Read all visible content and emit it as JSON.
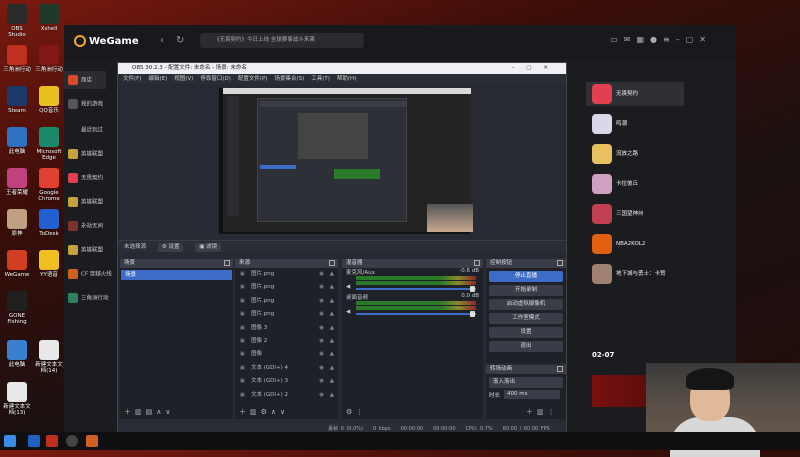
{
  "desktop": {
    "icons": [
      {
        "label": "OBS Studio",
        "color": "#2b2b2b"
      },
      {
        "label": "Xshell",
        "color": "#1f3a2a"
      },
      {
        "label": "三角洲行动",
        "color": "#c03020"
      },
      {
        "label": "三角洲行动",
        "color": "#801818"
      },
      {
        "label": "Steam",
        "color": "#1b3a6b"
      },
      {
        "label": "QQ音乐",
        "color": "#e8c020"
      },
      {
        "label": "此电脑",
        "color": "#3070c0"
      },
      {
        "label": "Microsoft Edge",
        "color": "#1a8a6a"
      },
      {
        "label": "王者荣耀",
        "color": "#c04080"
      },
      {
        "label": "Google Chrome",
        "color": "#e04030"
      },
      {
        "label": "原神",
        "color": "#c0a080"
      },
      {
        "label": "ToDesk",
        "color": "#2060d0"
      },
      {
        "label": "WeGame",
        "color": "#d04020"
      },
      {
        "label": "YY语音",
        "color": "#f0c020"
      },
      {
        "label": "GONE Fishing",
        "color": "#202020"
      },
      {
        "label": "此电脑",
        "color": "#3a80d0"
      },
      {
        "label": "新建文本文档(14)",
        "color": "#e8e8e8"
      },
      {
        "label": "新建文本文档(13)",
        "color": "#e8e8e8"
      }
    ]
  },
  "wegame": {
    "logo": "WeGame",
    "search_placeholder": "《无畏契约》今日上线 全球赛事战斗来袭",
    "sidebar": [
      {
        "label": "商店",
        "color": "#d94a2a",
        "active": true
      },
      {
        "label": "我的游戏",
        "color": "#555",
        "active": false
      },
      {
        "label": "最近玩过",
        "color": "transparent",
        "active": false
      },
      {
        "label": "英雄联盟",
        "color": "#c8a040",
        "active": false
      },
      {
        "label": "无畏契约",
        "color": "#e04050",
        "active": false
      },
      {
        "label": "英雄联盟",
        "color": "#c8a040",
        "active": false
      },
      {
        "label": "永劫无间",
        "color": "#803030",
        "active": false
      },
      {
        "label": "英雄联盟",
        "color": "#c8a040",
        "active": false
      },
      {
        "label": "CF 穿越火线",
        "color": "#d06020",
        "active": false
      },
      {
        "label": "三角洲行动",
        "color": "#308060",
        "active": false
      }
    ],
    "right_cards": [
      {
        "label": "无畏契约",
        "color": "#e04050"
      },
      {
        "label": "鸣潮",
        "color": "#d8d8e8"
      },
      {
        "label": "流放之路",
        "color": "#e8c060"
      },
      {
        "label": "卡拉彼丘",
        "color": "#d0a0c0"
      },
      {
        "label": "三国望神州",
        "color": "#c04050"
      },
      {
        "label": "NBA2KOL2",
        "color": "#e06010"
      },
      {
        "label": "地下城与勇士：卡赞",
        "color": "#a08070"
      }
    ],
    "date": "02-07"
  },
  "obs": {
    "title": "OBS 30.2.3 - 配置文件: 未命名 - 场景: 未命名",
    "menu": [
      "文件(F)",
      "编辑(E)",
      "视图(V)",
      "停靠窗口(D)",
      "配置文件(P)",
      "场景集合(S)",
      "工具(T)",
      "帮助(H)"
    ],
    "no_source": "未选择源",
    "props_btn": "⚙ 设置",
    "filters_btn": "▣ 滤镜",
    "scenes_title": "场景",
    "scene_item": "场景",
    "sources_title": "来源",
    "sources": [
      "图片.png",
      "图片.png",
      "图片.png",
      "图片.png",
      "图像 3",
      "图像 2",
      "图像",
      "文本 (GDI+) 4",
      "文本 (GDI+) 3",
      "文本 (GDI+) 2"
    ],
    "mixer_title": "混音器",
    "mic_label": "麦克风/Aux",
    "mic_db": "-0.6 dB",
    "desk_label": "桌面音频",
    "desk_db": "0.0 dB",
    "controls_title": "控制按钮",
    "controls": [
      "停止直播",
      "开始录制",
      "启动虚拟摄像机",
      "工作室模式",
      "设置",
      "退出"
    ],
    "transitions_title": "转场动画",
    "transition_value": "渐入渐出",
    "duration_label": "时长",
    "duration_value": "400 ms",
    "status": [
      "丢帧 0 (0.0%)",
      "0 kbps",
      "00:00:00",
      "00:00:00",
      "CPU: 0.7%",
      "60.00 / 60.00 FPS"
    ]
  }
}
